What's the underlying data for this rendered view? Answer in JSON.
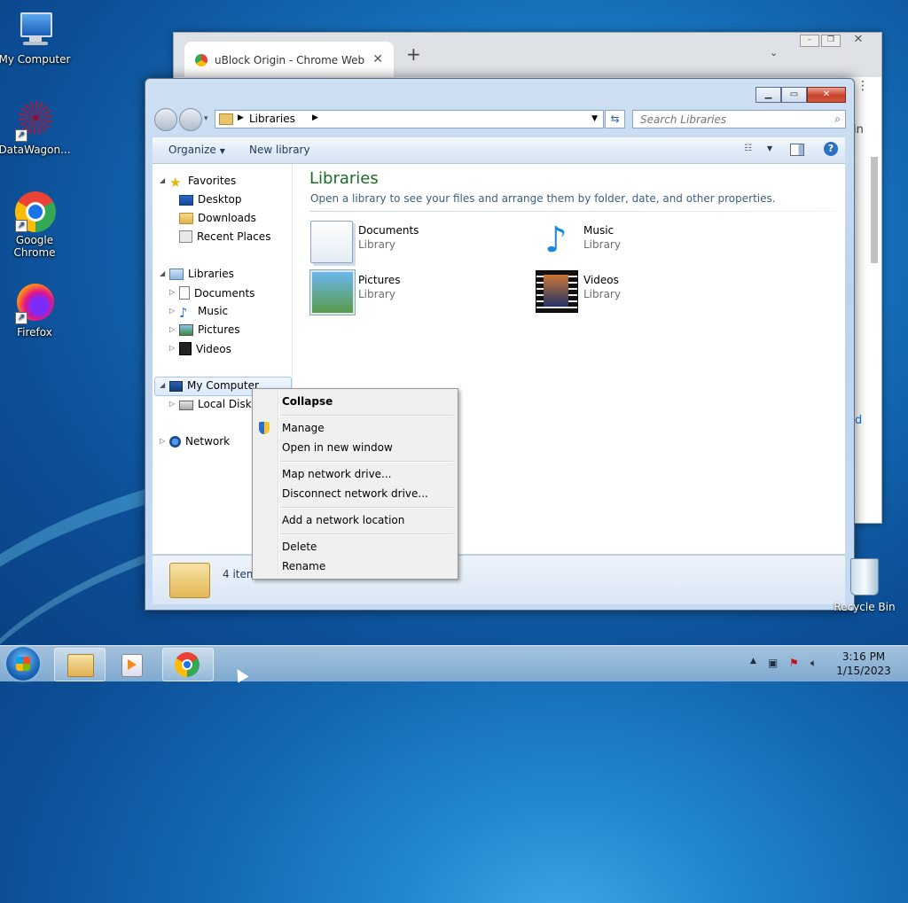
{
  "desktop": {
    "icons": [
      {
        "label": "My Computer"
      },
      {
        "label": "DataWagon..."
      },
      {
        "label": "Google Chrome"
      },
      {
        "label": "Firefox"
      }
    ],
    "recycle_bin": "Recycle Bin"
  },
  "chrome": {
    "tab_title": "uBlock Origin - Chrome Web Sto",
    "edge_text_1": "in",
    "edge_text_2": "d"
  },
  "explorer": {
    "breadcrumb": "Libraries",
    "search_placeholder": "Search Libraries",
    "toolbar": {
      "organize": "Organize",
      "new_library": "New library"
    },
    "nav": {
      "favorites": "Favorites",
      "desktop": "Desktop",
      "downloads": "Downloads",
      "recent": "Recent Places",
      "libraries": "Libraries",
      "documents": "Documents",
      "music": "Music",
      "pictures": "Pictures",
      "videos": "Videos",
      "my_computer": "My Computer",
      "local_disk": "Local Disk (",
      "network": "Network"
    },
    "main": {
      "title": "Libraries",
      "subtitle": "Open a library to see your files and arrange them by folder, date, and other properties.",
      "libraries": [
        {
          "name": "Documents",
          "kind": "Library"
        },
        {
          "name": "Music",
          "kind": "Library"
        },
        {
          "name": "Pictures",
          "kind": "Library"
        },
        {
          "name": "Videos",
          "kind": "Library"
        }
      ]
    },
    "details": {
      "count": "4 item"
    }
  },
  "context_menu": {
    "collapse": "Collapse",
    "manage": "Manage",
    "open_new": "Open in new window",
    "map_drive": "Map network drive...",
    "disconnect_drive": "Disconnect network drive...",
    "add_location": "Add a network location",
    "delete": "Delete",
    "rename": "Rename"
  },
  "taskbar": {
    "time": "3:16 PM",
    "date": "1/15/2023"
  }
}
